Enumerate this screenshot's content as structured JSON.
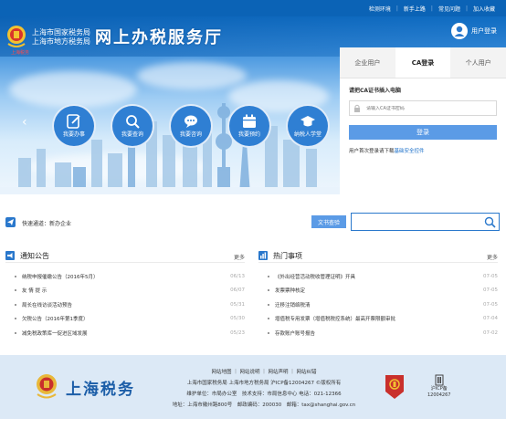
{
  "topbar": {
    "links": [
      "检测环境",
      "新手上路",
      "常见问题",
      "加入收藏"
    ]
  },
  "header": {
    "bureau_line1": "上海市国家税务局",
    "bureau_line2": "上海市地方税务局",
    "brand_sub": "上海税务",
    "site_title": "网上办税服务厅",
    "user_login": "用户登录"
  },
  "quick_icons": [
    {
      "label": "我要办事",
      "icon": "edit-icon"
    },
    {
      "label": "我要查询",
      "icon": "search-icon"
    },
    {
      "label": "我要咨询",
      "icon": "chat-icon"
    },
    {
      "label": "我要预约",
      "icon": "calendar-icon"
    },
    {
      "label": "纳税人学堂",
      "icon": "graduation-cap-icon"
    }
  ],
  "login": {
    "tabs": [
      "企业用户",
      "CA登录",
      "个人用户"
    ],
    "active_tab": "CA登录",
    "hint": "请把CA证书插入电脑",
    "input_placeholder": "请输入CA证书密码",
    "button": "登录",
    "note_prefix": "用户首次登录请下载",
    "note_link": "基础安全控件"
  },
  "search_row": {
    "fast_label": "快速通道：",
    "fast_value": "新办企业",
    "doc_search": "文书查验",
    "search_value": ""
  },
  "notice": {
    "title": "通知公告",
    "more": "更多",
    "items": [
      {
        "title": "纳税申报催缴公告（2016年5月）",
        "date": "06/13"
      },
      {
        "title": "友 情 提 示",
        "date": "06/07"
      },
      {
        "title": "局长在线访谈活动预告",
        "date": "05/31"
      },
      {
        "title": "欠税公告（2016年第1季度）",
        "date": "05/30"
      },
      {
        "title": "减免税政策库一促进区域发展",
        "date": "05/23"
      }
    ]
  },
  "hot": {
    "title": "热门事项",
    "more": "更多",
    "items": [
      {
        "title": "《外出经营活动税收管理证明》开具",
        "date": "07-05"
      },
      {
        "title": "发票票种核定",
        "date": "07-05"
      },
      {
        "title": "迁移注销络税清",
        "date": "07-05"
      },
      {
        "title": "增值税专用发票（增值税税控系统）最高开票限额审批",
        "date": "07-04"
      },
      {
        "title": "存款账户账号报告",
        "date": "07-02"
      }
    ]
  },
  "footer": {
    "logo_text": "上海税务",
    "links_line": "网站地图 ｜ 网站说明 ｜ 网站声明 ｜ 网站纠错",
    "line2": "上海市国家税务局 上海市地方税务局 沪ICP备12004267 ©版权所有",
    "line3": "维护单位：市局办公室　技术支持：市局信息中心 电话：021-12366",
    "line4": "地址：上海市徽州路800号　邮政编码：200030　邮箱：tax@shanghai.gov.cn",
    "icp_label": "沪ICP备",
    "icp_number": "12004267"
  },
  "colors": {
    "brand_blue": "#0b63b6",
    "accent_blue": "#5b9be6",
    "footer_bg": "#dce9f6"
  }
}
